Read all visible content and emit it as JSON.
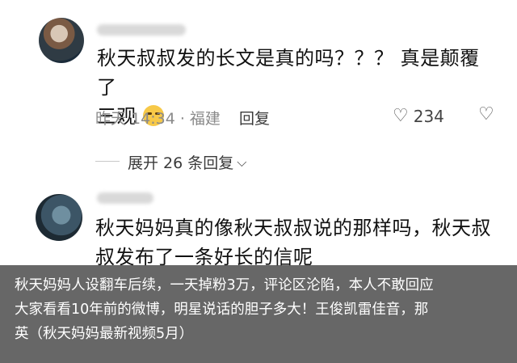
{
  "comments": [
    {
      "text_line1": "秋天叔叔发的长文是真的吗？？？ 真是颠覆了",
      "text_line2": "三观",
      "emoji_icon": "crying-face-icon",
      "time": "昨天 14:34 · 福建",
      "reply_label": "回复",
      "likes": "234",
      "expand_label": "展开 26 条回复"
    },
    {
      "text_line1": "秋天妈妈真的像秋天叔叔说的那样吗，秋天叔",
      "text_line2": "叔发布了一条好长的信呢"
    }
  ],
  "caption": {
    "line1": "秋天妈妈人设翻车后续，一天掉粉3万，评论区沦陷，本人不敢回应",
    "line2": "大家看看10年前的微博，明星说话的胆子多大！王俊凯雷佳音，那",
    "line3": "英（秋天妈妈最新视频5月）"
  }
}
